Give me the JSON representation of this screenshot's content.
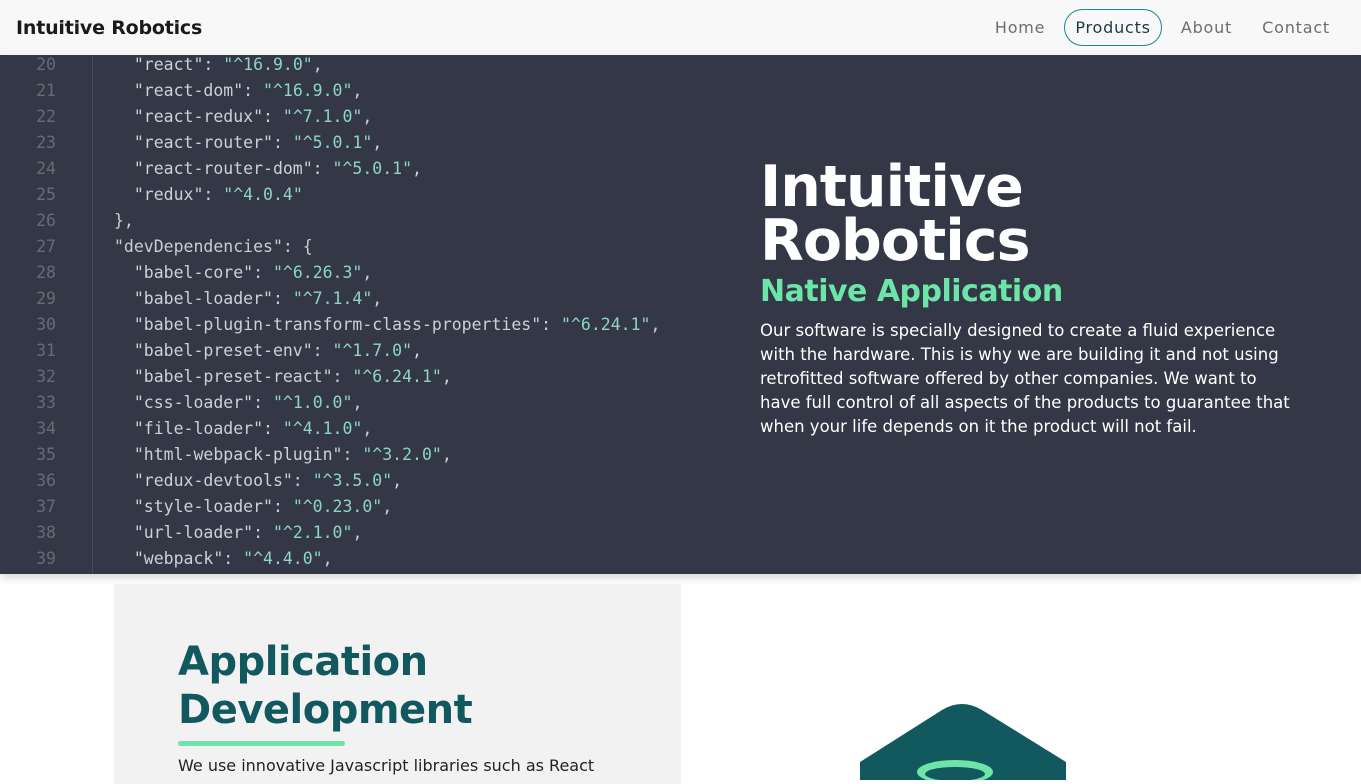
{
  "nav": {
    "brand": "Intuitive Robotics",
    "links": [
      {
        "label": "Home",
        "active": false
      },
      {
        "label": "Products",
        "active": true
      },
      {
        "label": "About",
        "active": false
      },
      {
        "label": "Contact",
        "active": false
      }
    ]
  },
  "hero": {
    "code_lines": [
      {
        "num": "20",
        "text": "  \"react\": \"^16.9.0\","
      },
      {
        "num": "21",
        "text": "  \"react-dom\": \"^16.9.0\","
      },
      {
        "num": "22",
        "text": "  \"react-redux\": \"^7.1.0\","
      },
      {
        "num": "23",
        "text": "  \"react-router\": \"^5.0.1\","
      },
      {
        "num": "24",
        "text": "  \"react-router-dom\": \"^5.0.1\","
      },
      {
        "num": "25",
        "text": "  \"redux\": \"^4.0.4\""
      },
      {
        "num": "26",
        "text": "},"
      },
      {
        "num": "27",
        "text": "\"devDependencies\": {"
      },
      {
        "num": "28",
        "text": "  \"babel-core\": \"^6.26.3\","
      },
      {
        "num": "29",
        "text": "  \"babel-loader\": \"^7.1.4\","
      },
      {
        "num": "30",
        "text": "  \"babel-plugin-transform-class-properties\": \"^6.24.1\","
      },
      {
        "num": "31",
        "text": "  \"babel-preset-env\": \"^1.7.0\","
      },
      {
        "num": "32",
        "text": "  \"babel-preset-react\": \"^6.24.1\","
      },
      {
        "num": "33",
        "text": "  \"css-loader\": \"^1.0.0\","
      },
      {
        "num": "34",
        "text": "  \"file-loader\": \"^4.1.0\","
      },
      {
        "num": "35",
        "text": "  \"html-webpack-plugin\": \"^3.2.0\","
      },
      {
        "num": "36",
        "text": "  \"redux-devtools\": \"^3.5.0\","
      },
      {
        "num": "37",
        "text": "  \"style-loader\": \"^0.23.0\","
      },
      {
        "num": "38",
        "text": "  \"url-loader\": \"^2.1.0\","
      },
      {
        "num": "39",
        "text": "  \"webpack\": \"^4.4.0\","
      }
    ],
    "title_line1": "Intuitive",
    "title_line2": "Robotics",
    "subtitle": "Native Application",
    "body": "Our software is specially designed to create a fluid experience with the hardware. This is why we are building it and not using retrofitted software offered by other companies. We want to have full control of all aspects of the products to guarantee that when your life depends on it the product will not fail."
  },
  "section": {
    "title_line1": "Application",
    "title_line2": "Development",
    "text": "We use innovative Javascript libraries such as React"
  },
  "colors": {
    "accent_green": "#6de5a8",
    "teal_dark": "#12595f",
    "hero_bg": "#343846",
    "active_border": "#1a8a8f"
  },
  "icons": {
    "section_logo": "react-logo-icon"
  }
}
